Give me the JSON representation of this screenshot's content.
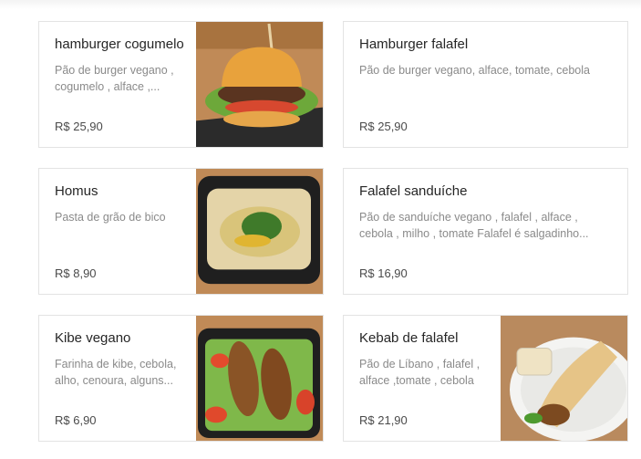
{
  "menu": {
    "items": [
      {
        "title": "hamburger cogumelo",
        "description": "Pão de burger vegano , cogumelo , alface ,...",
        "price": "R$ 25,90"
      },
      {
        "title": "Hamburger falafel",
        "description": "Pão de burger vegano, alface, tomate, cebola",
        "price": "R$ 25,90"
      },
      {
        "title": "Homus",
        "description": "Pasta de grão de bico",
        "price": "R$ 8,90"
      },
      {
        "title": "Falafel sanduíche",
        "description": "Pão de sanduíche vegano , falafel , alface , cebola , milho , tomate Falafel é salgadinho...",
        "price": "R$ 16,90"
      },
      {
        "title": "Kibe vegano",
        "description": "Farinha de kibe, cebola, alho, cenoura, alguns...",
        "price": "R$ 6,90"
      },
      {
        "title": "Kebab de falafel",
        "description": "Pão de Líbano , falafel , alface ,tomate , cebola",
        "price": "R$ 21,90"
      }
    ]
  }
}
